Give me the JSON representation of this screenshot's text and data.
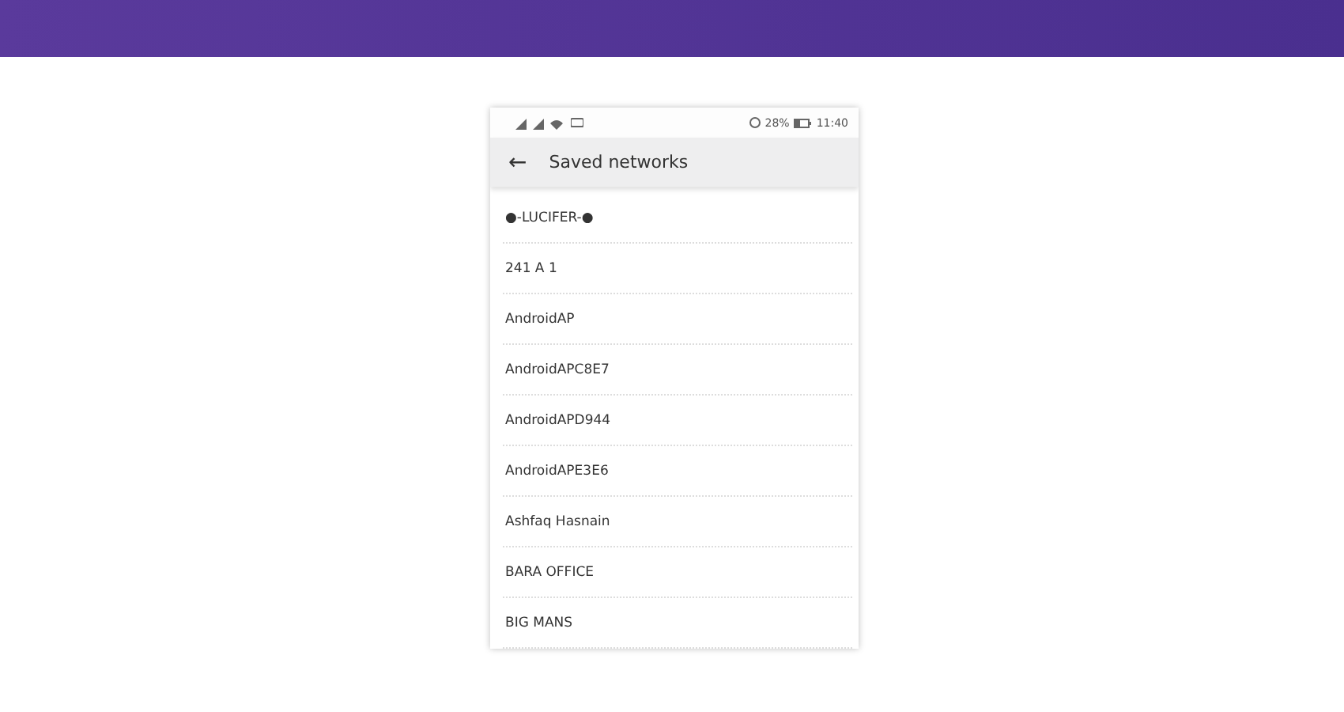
{
  "status_bar": {
    "battery_percent": "28%",
    "time": "11:40"
  },
  "app_bar": {
    "back": "←",
    "title": "Saved networks"
  },
  "networks": [
    {
      "name": "●-LUCIFER-●"
    },
    {
      "name": "241 A 1"
    },
    {
      "name": "AndroidAP"
    },
    {
      "name": "AndroidAPC8E7"
    },
    {
      "name": "AndroidAPD944"
    },
    {
      "name": "AndroidAPE3E6"
    },
    {
      "name": "Ashfaq Hasnain"
    },
    {
      "name": "BARA OFFICE"
    },
    {
      "name": "BIG MANS"
    }
  ]
}
